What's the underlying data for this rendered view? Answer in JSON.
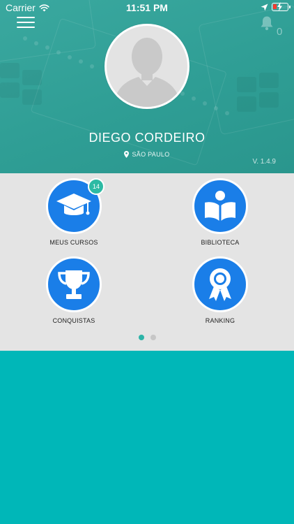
{
  "status_bar": {
    "carrier": "Carrier",
    "time": "11:51 PM"
  },
  "header": {
    "notification_count": "0",
    "user_name": "DIEGO CORDEIRO",
    "location": "SÃO PAULO",
    "version": "V. 1.4.9"
  },
  "tiles": [
    {
      "label": "MEUS CURSOS",
      "icon": "graduation-cap-icon",
      "badge": "14"
    },
    {
      "label": "BIBLIOTECA",
      "icon": "reading-person-icon"
    },
    {
      "label": "CONQUISTAS",
      "icon": "trophy-icon"
    },
    {
      "label": "RANKING",
      "icon": "award-ribbon-icon"
    }
  ],
  "pager": {
    "pages": 2,
    "active": 1
  },
  "colors": {
    "header_teal": "#2f9e95",
    "tile_blue": "#1a7ee8",
    "badge_teal": "#2dbaa4",
    "panel_gray": "#e4e4e4",
    "bottom_teal": "#00b7b8",
    "battery_red": "#ff3b30"
  }
}
